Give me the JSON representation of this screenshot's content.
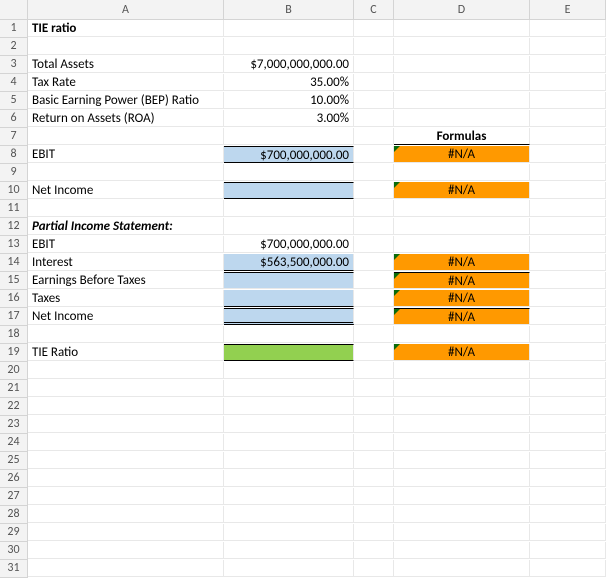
{
  "columns": [
    "A",
    "B",
    "C",
    "D",
    "E"
  ],
  "rowCount": 31,
  "cells": {
    "A1": "TIE ratio",
    "A3": "Total Assets",
    "B3": "$7,000,000,000.00",
    "A4": "Tax Rate",
    "B4": "35.00%",
    "A5": "Basic Earning Power (BEP) Ratio",
    "B5": "10.00%",
    "A6": "Return on Assets (ROA)",
    "B6": "3.00%",
    "D7": "Formulas",
    "A8": "EBIT",
    "B8": "$700,000,000.00",
    "D8": "#N/A",
    "A10": "Net Income",
    "D10": "#N/A",
    "A12": "Partial Income Statement:",
    "A13": "EBIT",
    "B13": "$700,000,000.00",
    "A14": "Interest",
    "B14": "$563,500,000.00",
    "D14": "#N/A",
    "A15": "Earnings Before Taxes",
    "D15": "#N/A",
    "A16": "Taxes",
    "D16": "#N/A",
    "A17": "Net Income",
    "D17": "#N/A",
    "A19": "TIE Ratio",
    "D19": "#N/A"
  },
  "chart_data": {
    "type": "table",
    "title": "TIE ratio",
    "inputs": {
      "Total Assets": 7000000000.0,
      "Tax Rate": 0.35,
      "Basic Earning Power (BEP) Ratio": 0.1,
      "Return on Assets (ROA)": 0.03
    },
    "outputs": {
      "EBIT": 700000000.0,
      "Net Income": null,
      "Partial Income Statement": {
        "EBIT": 700000000.0,
        "Interest": 563500000.0,
        "Earnings Before Taxes": null,
        "Taxes": null,
        "Net Income": null
      },
      "TIE Ratio": null
    },
    "formulas_column": [
      "#N/A",
      "#N/A",
      "#N/A",
      "#N/A",
      "#N/A",
      "#N/A",
      "#N/A"
    ]
  }
}
